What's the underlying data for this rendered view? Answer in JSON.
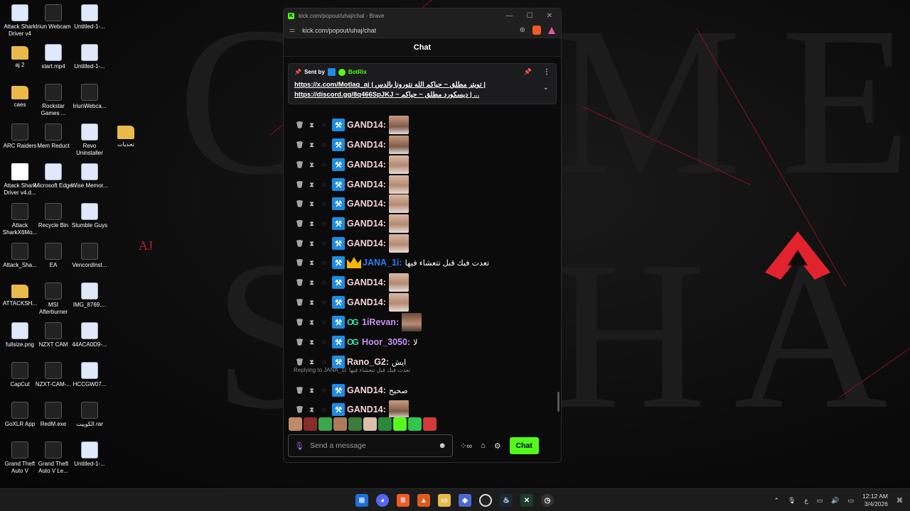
{
  "window": {
    "title": "kick.com/popout/uhaj/chat - Brave",
    "url": "kick.com/popout/uhaj/chat",
    "controls": {
      "minimize": "—",
      "maximize": "☐",
      "close": "✕"
    }
  },
  "chat": {
    "header": "Chat",
    "pinned": {
      "sent_by_label": "Sent by",
      "sender": "BotRix",
      "line1": "https://x.com/Motlaq_aj | تويتر مطلق ~ حياكم الله نتورونا بالدس |",
      "line2": "https://discord.gg/8q466SpJKJ ~ ديسكورد مطلق ~ حياكم | ..."
    },
    "messages": [
      {
        "user": "GAND14:",
        "color": "#f6d3d3",
        "emote": "man",
        "text": ""
      },
      {
        "user": "GAND14:",
        "color": "#f6d3d3",
        "emote": "man",
        "text": ""
      },
      {
        "user": "GAND14:",
        "color": "#f6d3d3",
        "emote": "baby",
        "text": ""
      },
      {
        "user": "GAND14:",
        "color": "#f6d3d3",
        "emote": "baby",
        "text": ""
      },
      {
        "user": "GAND14:",
        "color": "#f6d3d3",
        "emote": "baby",
        "text": ""
      },
      {
        "user": "GAND14:",
        "color": "#f6d3d3",
        "emote": "baby",
        "text": ""
      },
      {
        "user": "GAND14:",
        "color": "#f6d3d3",
        "emote": "baby",
        "text": ""
      },
      {
        "user": "JANA_1i:",
        "color": "#2d7bf5",
        "emote": "",
        "text": "تعدت فيك قبل تتعشاء فيها"
      },
      {
        "user": "GAND14:",
        "color": "#f6d3d3",
        "emote": "baby",
        "text": ""
      },
      {
        "user": "GAND14:",
        "color": "#f6d3d3",
        "emote": "baby",
        "text": ""
      },
      {
        "user": "1iRevan:",
        "color": "#c792f2",
        "emote": "kid",
        "text": ""
      },
      {
        "user": "Hoor_3050:",
        "color": "#c792f2",
        "emote": "",
        "text": "لا"
      },
      {
        "user": "Rano_G2:",
        "color": "#f2d6d6",
        "emote": "",
        "text": "ايش"
      },
      {
        "user": "GAND14:",
        "color": "#f6d3d3",
        "emote": "",
        "text": "صحيح"
      },
      {
        "user": "GAND14:",
        "color": "#f6d3d3",
        "emote": "man",
        "text": ""
      }
    ],
    "reply_label": "Replying to JANA_1i: تعدت فيك قبل تتعشاء فيها",
    "input_placeholder": "Send a message",
    "send_label": "Chat",
    "colors": {
      "accent": "#53fc18",
      "mod_badge": "#1e8ce0"
    }
  },
  "desktop": {
    "icons": [
      {
        "label": "Attack Shark Driver v4",
        "kind": "img"
      },
      {
        "label": "Iriun Webcam",
        "kind": "dark"
      },
      {
        "label": "Untitled-1-...",
        "kind": "img"
      },
      {
        "label": "aj 2",
        "kind": "folder"
      },
      {
        "label": "start.mp4",
        "kind": "img"
      },
      {
        "label": "Untitled-1-...",
        "kind": "img"
      },
      {
        "label": "caes",
        "kind": "folder"
      },
      {
        "label": "Rockstar Games ...",
        "kind": "dark"
      },
      {
        "label": "IriunWebca...",
        "kind": "dark"
      },
      {
        "label": "ARC Raiders",
        "kind": "dark"
      },
      {
        "label": "Mem Reduct",
        "kind": "dark"
      },
      {
        "label": "Revo Uninstaller",
        "kind": "img"
      },
      {
        "label": "تحديات",
        "kind": "folder"
      },
      {
        "label": "Attack Shark Driver v4.d...",
        "kind": "doc"
      },
      {
        "label": "Microsoft Edge",
        "kind": "img"
      },
      {
        "label": "Wise Memor...",
        "kind": "img"
      },
      {
        "label": "Attack SharkX6Mo...",
        "kind": "dark"
      },
      {
        "label": "Recycle Bin",
        "kind": "dark"
      },
      {
        "label": "Stumble Guys",
        "kind": "img"
      },
      {
        "label": "Attack_Sha...",
        "kind": "dark"
      },
      {
        "label": "EA",
        "kind": "dark"
      },
      {
        "label": "VencordInst...",
        "kind": "dark"
      },
      {
        "label": "ATTACKSH...",
        "kind": "folder"
      },
      {
        "label": "MSI Afterburner",
        "kind": "dark"
      },
      {
        "label": "IMG_8769....",
        "kind": "img"
      },
      {
        "label": "fullsize.png",
        "kind": "img"
      },
      {
        "label": "NZXT CAM",
        "kind": "dark"
      },
      {
        "label": "44ACA0D9-...",
        "kind": "img"
      },
      {
        "label": "CapCut",
        "kind": "dark"
      },
      {
        "label": "NZXT-CAM-...",
        "kind": "dark"
      },
      {
        "label": "HCCGW07...",
        "kind": "img"
      },
      {
        "label": "GoXLR App",
        "kind": "dark"
      },
      {
        "label": "RedM.exe",
        "kind": "dark"
      },
      {
        "label": "الكوبيت.rar",
        "kind": "dark"
      },
      {
        "label": "Grand Theft Auto V",
        "kind": "dark"
      },
      {
        "label": "Grand Theft Auto V Le...",
        "kind": "dark"
      },
      {
        "label": "Untitled-1-...",
        "kind": "img"
      }
    ],
    "wallpaper_text": "AJ"
  },
  "taskbar": {
    "time": "12:12 AM",
    "date": "3/4/2026",
    "lang": "ع"
  }
}
